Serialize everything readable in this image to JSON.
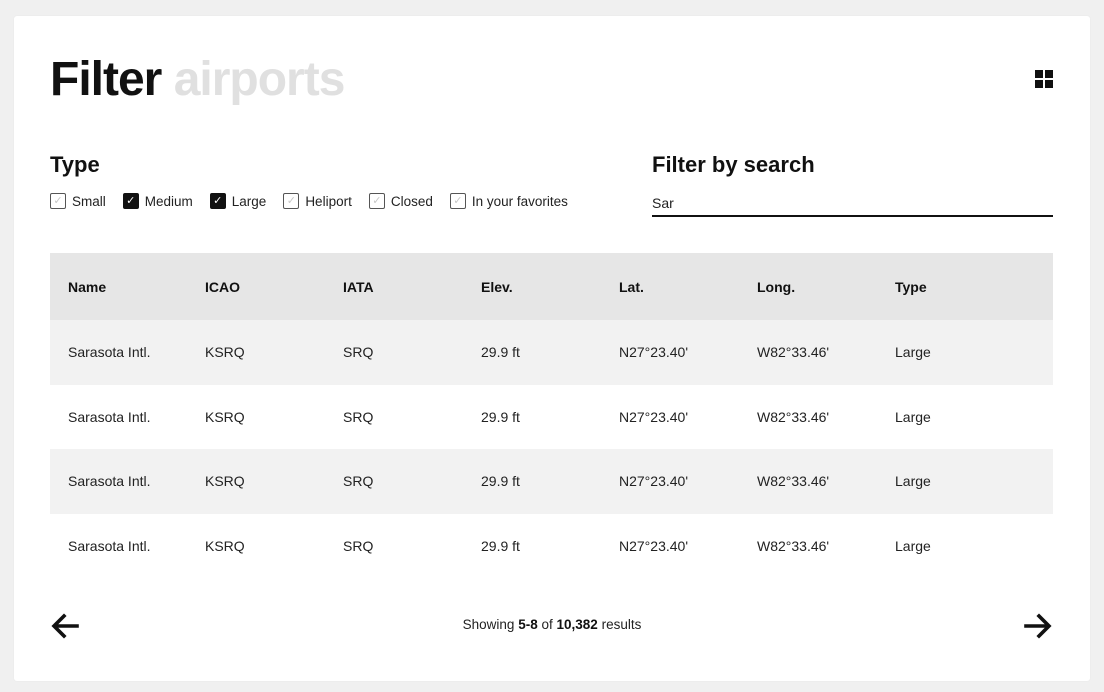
{
  "header": {
    "title_strong": "Filter",
    "title_light": "airports",
    "view_toggle_icon": "grid-icon"
  },
  "filters": {
    "type_label": "Type",
    "types": [
      {
        "label": "Small",
        "checked": false
      },
      {
        "label": "Medium",
        "checked": true
      },
      {
        "label": "Large",
        "checked": true
      },
      {
        "label": "Heliport",
        "checked": false
      },
      {
        "label": "Closed",
        "checked": false
      },
      {
        "label": "In your favorites",
        "checked": false
      }
    ],
    "search_label": "Filter by search",
    "search_value": "Sar"
  },
  "table": {
    "columns": [
      "Name",
      "ICAO",
      "IATA",
      "Elev.",
      "Lat.",
      "Long.",
      "Type"
    ],
    "rows": [
      [
        "Sarasota Intl.",
        "KSRQ",
        "SRQ",
        "29.9 ft",
        "N27°23.40'",
        "W82°33.46'",
        "Large"
      ],
      [
        "Sarasota Intl.",
        "KSRQ",
        "SRQ",
        "29.9 ft",
        "N27°23.40'",
        "W82°33.46'",
        "Large"
      ],
      [
        "Sarasota Intl.",
        "KSRQ",
        "SRQ",
        "29.9 ft",
        "N27°23.40'",
        "W82°33.46'",
        "Large"
      ],
      [
        "Sarasota Intl.",
        "KSRQ",
        "SRQ",
        "29.9 ft",
        "N27°23.40'",
        "W82°33.46'",
        "Large"
      ]
    ]
  },
  "pagination": {
    "prefix": "Showing",
    "range": "5-8",
    "of": "of",
    "total": "10,382",
    "suffix": "results",
    "prev_icon": "arrow-left-icon",
    "next_icon": "arrow-right-icon"
  },
  "colors": {
    "title_light": "#e0e0e0",
    "header_row_bg": "#e6e6e6",
    "striped_row_bg": "#f2f2f2",
    "page_bg": "#f0f0f0"
  }
}
